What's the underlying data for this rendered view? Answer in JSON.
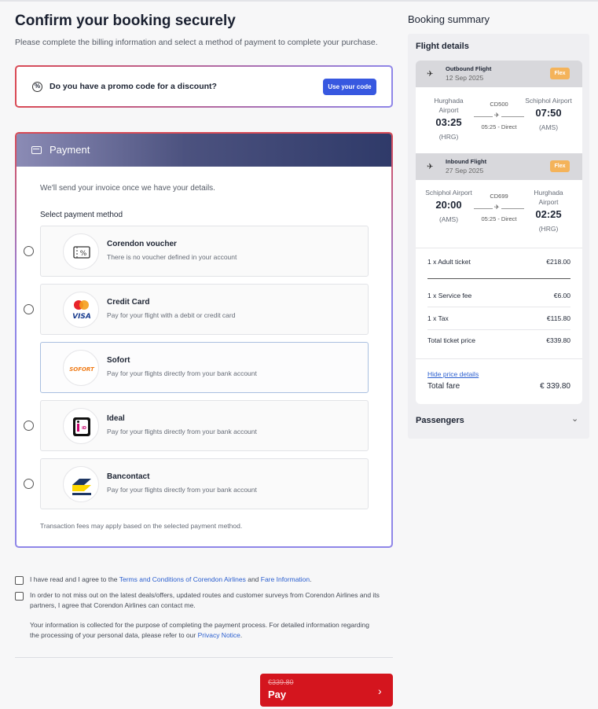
{
  "page": {
    "title": "Confirm your booking securely",
    "subtitle": "Please complete the billing information and select a method of payment to complete your purchase."
  },
  "promo": {
    "question": "Do you have a promo code for a discount?",
    "button_label": "Use your code"
  },
  "payment": {
    "header": "Payment",
    "info": "We'll send your invoice once we have your details.",
    "select_label": "Select payment method",
    "methods": [
      {
        "title": "Corendon voucher",
        "desc": "There is no voucher defined in your account",
        "icon": "voucher-icon",
        "selected": false
      },
      {
        "title": "Credit Card",
        "desc": "Pay for your flight with a debit or credit card",
        "icon": "mastercard-visa-logo",
        "selected": false
      },
      {
        "title": "Sofort",
        "desc": "Pay for your flights directly from your bank account",
        "icon": "sofort-logo",
        "selected": true
      },
      {
        "title": "Ideal",
        "desc": "Pay for your flights directly from your bank account",
        "icon": "ideal-logo",
        "selected": false
      },
      {
        "title": "Bancontact",
        "desc": "Pay for your flights directly from your bank account",
        "icon": "bancontact-logo",
        "selected": false
      }
    ],
    "fees_note": "Transaction fees may apply based on the selected payment method."
  },
  "consent": {
    "terms_prefix": "I have read and I agree to the ",
    "terms_link": "Terms and Conditions of Corendon Airlines",
    "terms_and": " and ",
    "fare_link": "Fare Information",
    "terms_suffix": ".",
    "marketing": "In order to not miss out on the latest deals/offers, updated routes and customer surveys from Corendon Airlines and its partners, I agree that Corendon Airlines can contact me.",
    "privacy_prefix": "Your information is collected for the purpose of completing the payment process. For detailed information regarding the processing of your personal data, please refer to our ",
    "privacy_link": "Privacy Notice",
    "privacy_suffix": "."
  },
  "pay_button": {
    "old_price": "€339.80",
    "label": "Pay"
  },
  "summary": {
    "title": "Booking summary",
    "flight_details": "Flight details",
    "outbound": {
      "label": "Outbound Flight",
      "date": "12 Sep 2025",
      "tag": "Flex",
      "from_name": "Hurghada Airport",
      "from_time": "03:25",
      "from_code": "(HRG)",
      "flight_no": "CD500",
      "duration": "05:25 - Direct",
      "to_name": "Schiphol Airport",
      "to_time": "07:50",
      "to_code": "(AMS)"
    },
    "inbound": {
      "label": "Inbound Flight",
      "date": "27 Sep 2025",
      "tag": "Flex",
      "from_name": "Schiphol Airport",
      "from_time": "20:00",
      "from_code": "(AMS)",
      "flight_no": "CD699",
      "duration": "05:25 - Direct",
      "to_name": "Hurghada Airport",
      "to_time": "02:25",
      "to_code": "(HRG)"
    },
    "prices": [
      {
        "label": "1 x Adult ticket",
        "value": "€218.00"
      },
      {
        "label": "1 x Service fee",
        "value": "€6.00"
      },
      {
        "label": "1 x Tax",
        "value": "€115.80"
      },
      {
        "label": "Total ticket price",
        "value": "€339.80"
      }
    ],
    "hide_link": "Hide price details",
    "total_label": "Total fare",
    "total_value": "€ 339.80",
    "passengers": "Passengers"
  }
}
